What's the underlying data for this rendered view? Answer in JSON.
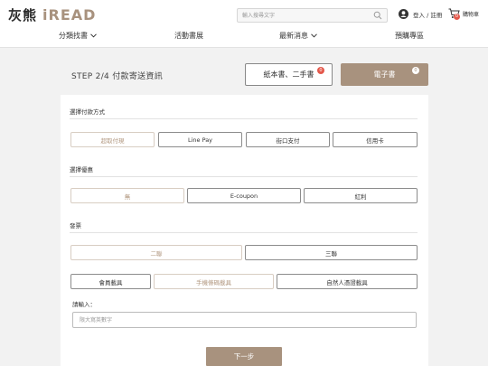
{
  "header": {
    "logo_zh": "灰熊",
    "logo_en": "iREAD",
    "search": {
      "placeholder": "輸入搜尋文字",
      "value": ""
    },
    "login_label": "登入 / 註冊",
    "cart_label": "購物車",
    "cart_count": "0"
  },
  "nav": {
    "items": [
      {
        "label": "分類找書"
      },
      {
        "label": "活動書展"
      },
      {
        "label": "最新消息"
      },
      {
        "label": "預購專區"
      }
    ]
  },
  "checkout": {
    "step_title": "STEP 2/4  付款寄送資訊",
    "paper_books_label": "紙本書、二手書",
    "paper_books_count": "0",
    "ebook_label": "電子書",
    "ebook_count": "0"
  },
  "payment": {
    "label": "選擇付款方式",
    "options": [
      "超取付現",
      "Line Pay",
      "街口支付",
      "信用卡"
    ],
    "selected": "超取付現"
  },
  "discount": {
    "label": "選擇優惠",
    "options": [
      "無",
      "E-coupon",
      "紅利"
    ],
    "selected": "無"
  },
  "invoice": {
    "label": "發票",
    "types": [
      "二聯",
      "三聯"
    ],
    "selected_type": "二聯",
    "carriers": [
      "會員載具",
      "手機條碼載具",
      "自然人憑證載具"
    ],
    "selected_carrier": "手機條碼載具",
    "input_label": "請輸入：",
    "input_placeholder": "限大寫英數字",
    "input_value": ""
  },
  "next_label": "下一步",
  "colors": {
    "accent": "#a8927e",
    "badge": "#e4584b",
    "page_bg": "#f2f2f2"
  }
}
